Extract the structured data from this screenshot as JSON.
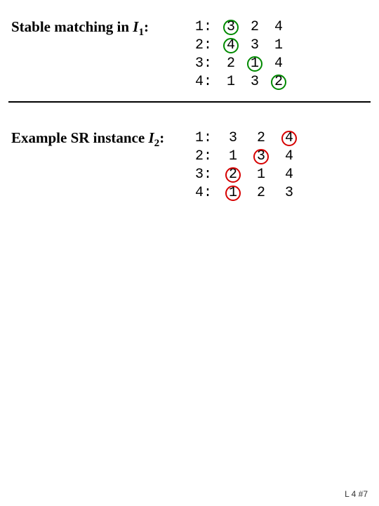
{
  "section1": {
    "label_pre": "Stable matching in ",
    "label_var": "I",
    "label_sub": "1",
    "label_post": ":",
    "rows": [
      {
        "id": "1:",
        "cells": [
          {
            "v": "3",
            "mark": "green"
          },
          {
            "v": "2"
          },
          {
            "v": "4"
          }
        ]
      },
      {
        "id": "2:",
        "cells": [
          {
            "v": "4",
            "mark": "green"
          },
          {
            "v": "3"
          },
          {
            "v": "1"
          }
        ]
      },
      {
        "id": "3:",
        "cells": [
          {
            "v": "2"
          },
          {
            "v": "1",
            "mark": "green"
          },
          {
            "v": "4"
          }
        ]
      },
      {
        "id": "4:",
        "cells": [
          {
            "v": "1"
          },
          {
            "v": "3"
          },
          {
            "v": "2",
            "mark": "green"
          }
        ]
      }
    ]
  },
  "section2": {
    "label_pre": "Example SR instance ",
    "label_var": "I",
    "label_sub": "2",
    "label_post": ":",
    "rows": [
      {
        "id": "1:",
        "cells": [
          {
            "v": "3"
          },
          {
            "v": "2"
          },
          {
            "v": "4",
            "mark": "red"
          }
        ]
      },
      {
        "id": "2:",
        "cells": [
          {
            "v": "1"
          },
          {
            "v": "3",
            "mark": "red"
          },
          {
            "v": "4"
          }
        ]
      },
      {
        "id": "3:",
        "cells": [
          {
            "v": "2",
            "mark": "red"
          },
          {
            "v": "1"
          },
          {
            "v": "4"
          }
        ]
      },
      {
        "id": "4:",
        "cells": [
          {
            "v": "1",
            "mark": "red"
          },
          {
            "v": "2"
          },
          {
            "v": "3"
          }
        ]
      }
    ]
  },
  "footer": "L 4 #7"
}
